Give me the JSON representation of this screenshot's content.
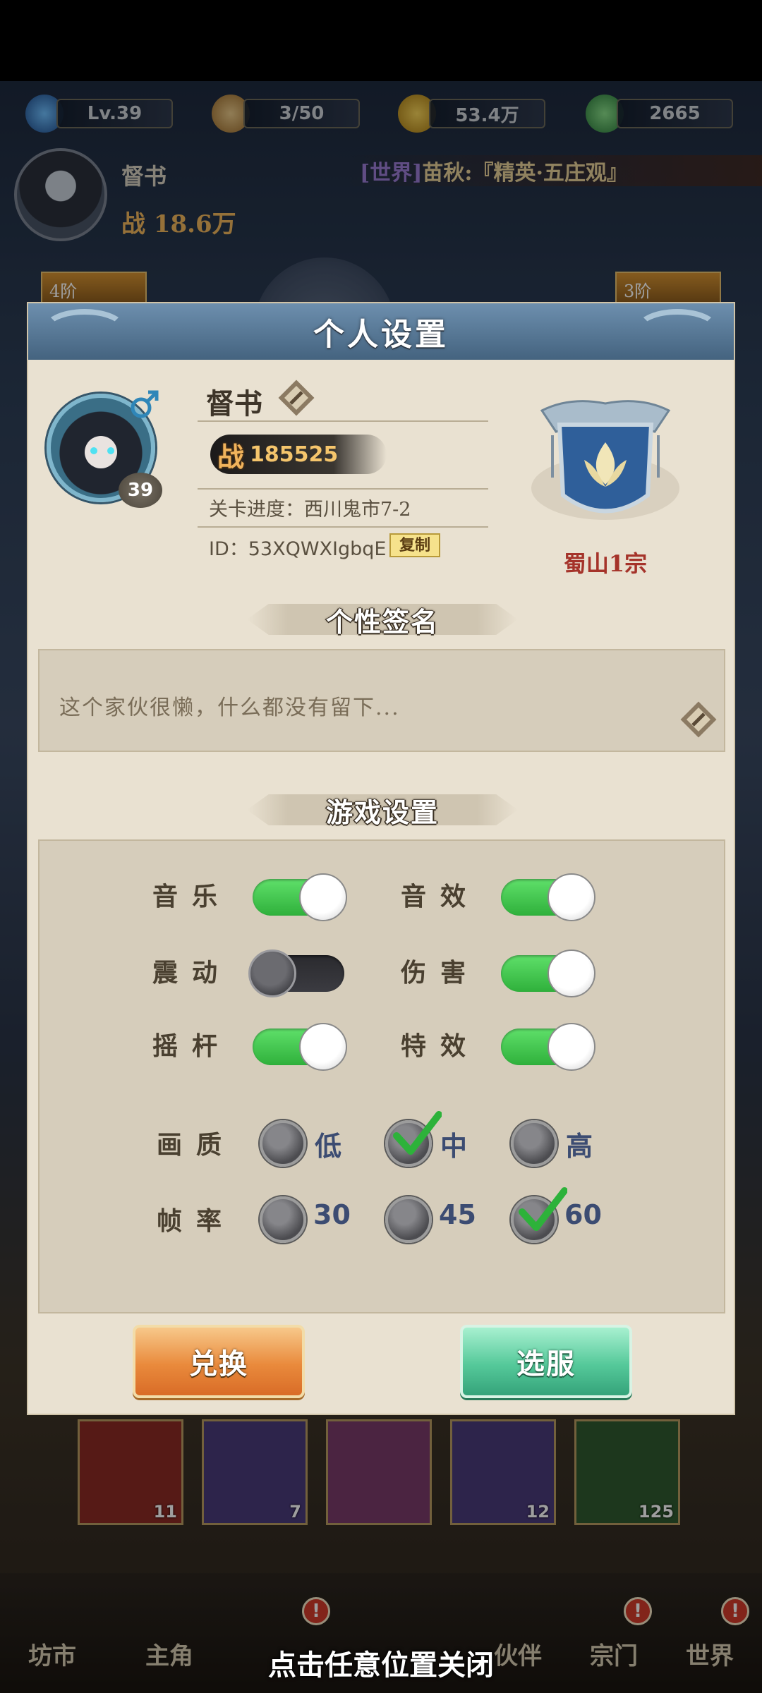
{
  "hud": {
    "level": "Lv.39",
    "stamina": "3/50",
    "coins": "53.4万",
    "jade": "2665",
    "player_name": "督书",
    "power": "战 18.6万",
    "world_tag": "[世界]",
    "world_message": "苗秋:『精英·五庄观』",
    "tier_left": "4阶",
    "tier_right": "3阶"
  },
  "background_items": [
    {
      "count": "11",
      "color": "#8b2a25"
    },
    {
      "count": "7",
      "color": "#4a3a7a"
    },
    {
      "count": "",
      "color": "#7a3a6a"
    },
    {
      "count": "12",
      "color": "#4a3a7a"
    },
    {
      "count": "125",
      "color": "#2f5a2f"
    }
  ],
  "bottom_nav": [
    {
      "label": "坊市",
      "badge": false
    },
    {
      "label": "主角",
      "badge": false
    },
    {
      "label": "",
      "badge": true
    },
    {
      "label": "",
      "badge": false
    },
    {
      "label": "伙伴",
      "badge": false
    },
    {
      "label": "宗门",
      "badge": true
    },
    {
      "label": "世界",
      "badge": true
    }
  ],
  "close_hint": "点击任意位置关闭",
  "panel": {
    "title": "个人设置",
    "profile": {
      "name": "督书",
      "level": "39",
      "gender": "male",
      "power_char": "战",
      "power": "185525",
      "stage_progress": "关卡进度：西川鬼市7-2",
      "id_text": "ID：53XQWXIgbqE",
      "copy_label": "复制",
      "sect": "蜀山1宗"
    },
    "signature": {
      "title": "个性签名",
      "text": "这个家伙很懒，什么都没有留下..."
    },
    "game_settings": {
      "title": "游戏设置",
      "toggles": [
        {
          "label": "音乐",
          "on": true
        },
        {
          "label": "音效",
          "on": true
        },
        {
          "label": "震动",
          "on": false
        },
        {
          "label": "伤害",
          "on": true
        },
        {
          "label": "摇杆",
          "on": true
        },
        {
          "label": "特效",
          "on": true
        }
      ],
      "quality": {
        "label": "画质",
        "options": [
          "低",
          "中",
          "高"
        ],
        "selected": "中"
      },
      "framerate": {
        "label": "帧率",
        "options": [
          "30",
          "45",
          "60"
        ],
        "selected": "60"
      }
    },
    "buttons": {
      "exchange": "兑换",
      "server": "选服"
    }
  },
  "colors": {
    "toggle_on": "#3fc84b",
    "toggle_off": "#2e2e33",
    "sect_name": "#a5332a",
    "radio_label": "#3c4c72",
    "check": "#2db23a"
  }
}
